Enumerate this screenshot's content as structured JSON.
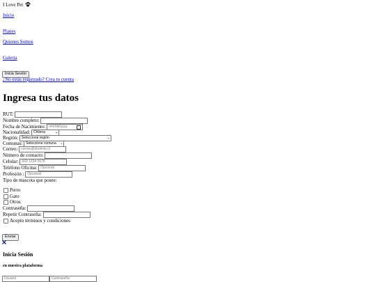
{
  "brand": {
    "name": "I Love Pet",
    "icon": "paw-icon"
  },
  "nav": [
    "Inicio",
    "Planes",
    "Quienes Somos",
    "Galeria"
  ],
  "auth": {
    "login_button": "Inicia Sesión",
    "register_link": "¿No estás registrado? Crea tu cuenta"
  },
  "form": {
    "title": "Ingresa tus datos",
    "rut_label": "RUT:",
    "name_label": "Nombre completo:",
    "birth_label": "Fecha de Nacimiento:",
    "birth_placeholder": "mm/dd/yyyy",
    "nationality_label": "Nacionalidad:",
    "nationality_value": "Chilena",
    "region_label": "Región:",
    "region_value": "Seleccione región",
    "commune_label": "Comunas:",
    "commune_value": "Seleccione comuna",
    "email_label": "Correo:",
    "email_placeholder": "correo@dominio.cl",
    "contact_label": "Número de contacto:",
    "cell_label": "Celular:",
    "cell_placeholder": "569 1234 5678",
    "office_label": "Teléfono Oficina:",
    "office_placeholder": "Opcional",
    "profession_label": "Profesión :",
    "profession_placeholder": "Opcional",
    "pet_type_label": "Tipo de mascota que posee:",
    "pets": [
      "Perro",
      "Gato",
      "Otros"
    ],
    "password_label": "Contraseña:",
    "repeat_password_label": "Repetir Contraseña:",
    "terms_label": "Acepto términos y condiciones",
    "submit_label": "Enviar"
  },
  "modal": {
    "close_icon": "close-icon",
    "title": "Inicia Sesión",
    "subtitle": "en nuestra plataforma",
    "user_placeholder": "Usuario",
    "password_placeholder": "Contraseña"
  }
}
